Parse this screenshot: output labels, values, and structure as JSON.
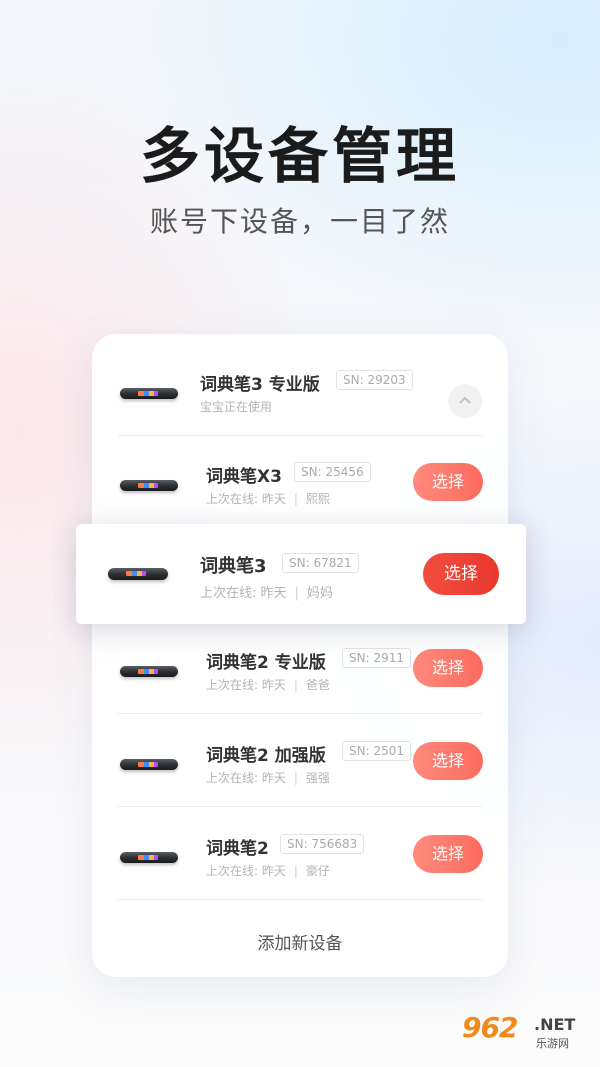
{
  "headline": "多设备管理",
  "subline": "账号下设备，一目了然",
  "devices": [
    {
      "name": "词典笔3 专业版",
      "sn": "SN: 29203",
      "status": "宝宝正在使用",
      "last": "",
      "user": ""
    },
    {
      "name": "词典笔X3",
      "sn": "SN: 25456",
      "last": "上次在线: 昨天",
      "user": "熙熙",
      "button": "选择"
    },
    {
      "name": "词典笔3",
      "sn": "SN: 67821",
      "last": "上次在线: 昨天",
      "user": "妈妈",
      "button": "选择"
    },
    {
      "name": "词典笔2 专业版",
      "sn": "SN: 2911",
      "last": "上次在线: 昨天",
      "user": "爸爸",
      "button": "选择"
    },
    {
      "name": "词典笔2 加强版",
      "sn": "SN: 2501",
      "last": "上次在线: 昨天",
      "user": "强强",
      "button": "选择"
    },
    {
      "name": "词典笔2",
      "sn": "SN: 756683",
      "last": "上次在线: 昨天",
      "user": "豪仔",
      "button": "选择"
    }
  ],
  "separator": "|",
  "add_label": "添加新设备",
  "watermark": {
    "number": "962",
    "suffix": ".NET",
    "sub": "乐游网"
  },
  "colors": {
    "accent": "#e8392d",
    "button": "#fb6b5e",
    "title": "#1b1b1b"
  },
  "icons": {
    "collapse": "chevron-up-icon",
    "device": "pen-device-icon"
  }
}
